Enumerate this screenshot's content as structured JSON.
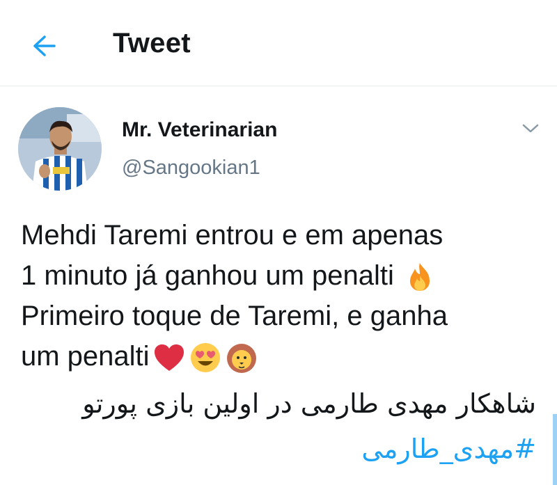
{
  "header": {
    "title": "Tweet",
    "back_icon": "arrow-left-icon"
  },
  "tweet": {
    "author_name": "Mr. Veterinarian",
    "author_handle": "@Sangookian1",
    "menu_icon": "chevron-down-icon",
    "lines": [
      "Mehdi Taremi entrou e em apenas",
      "1 minuto já ganhou um penalti",
      "Primeiro toque de Taremi, e ganha",
      "um penalti"
    ],
    "line2_emoji": "fire-emoji",
    "line4_emojis": [
      "red-heart-emoji",
      "heart-eyes-emoji",
      "lion-face-emoji"
    ],
    "persian_text": "شاهکار مهدی طارمی در اولین بازی پورتو",
    "hashtag": "#مهدی_طارمی"
  },
  "colors": {
    "accent": "#1da1f2",
    "text": "#14171a",
    "secondary_text": "#657786",
    "divider": "#e6ecf0"
  }
}
